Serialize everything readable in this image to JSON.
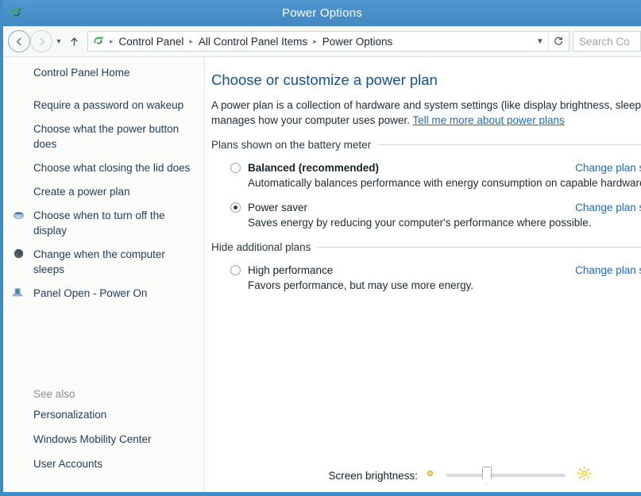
{
  "window": {
    "title": "Power Options",
    "icon": "power-plug-icon"
  },
  "navigation": {
    "back_icon": "back-arrow-icon",
    "forward_icon": "forward-arrow-icon",
    "recent_icon": "chevron-down-icon",
    "up_icon": "up-arrow-icon",
    "breadcrumb_icon": "power-plug-icon",
    "breadcrumbs": [
      "Control Panel",
      "All Control Panel Items",
      "Power Options"
    ],
    "separator": "▸",
    "dropdown_icon": "chevron-down-icon",
    "refresh_icon": "refresh-icon",
    "search_placeholder": "Search Co"
  },
  "sidebar": {
    "home_label": "Control Panel Home",
    "items": [
      {
        "label": "Require a password on wakeup",
        "icon": ""
      },
      {
        "label": "Choose what the power button does",
        "icon": ""
      },
      {
        "label": "Choose what closing the lid does",
        "icon": ""
      },
      {
        "label": "Create a power plan",
        "icon": ""
      },
      {
        "label": "Choose when to turn off the display",
        "icon": "display-icon"
      },
      {
        "label": "Change when the computer sleeps",
        "icon": "sleep-moon-icon"
      },
      {
        "label": "Panel Open - Power On",
        "icon": "laptop-icon"
      }
    ],
    "see_also": {
      "title": "See also",
      "items": [
        {
          "label": "Personalization"
        },
        {
          "label": "Windows Mobility Center"
        },
        {
          "label": "User Accounts"
        }
      ]
    }
  },
  "main": {
    "page_title": "Choose or customize a power plan",
    "intro_text": "A power plan is a collection of hardware and system settings (like display brightness, sleep) that manages how your computer uses power.",
    "intro_link": "Tell me more about power plans",
    "sections": [
      {
        "heading": "Plans shown on the battery meter",
        "plans": [
          {
            "name": "Balanced (recommended)",
            "bold": true,
            "selected": false,
            "description": "Automatically balances performance with energy consumption on capable hardware.",
            "change_label": "Change plan settings"
          },
          {
            "name": "Power saver",
            "bold": false,
            "selected": true,
            "description": "Saves energy by reducing your computer's performance where possible.",
            "change_label": "Change plan settings"
          }
        ]
      },
      {
        "heading": "Hide additional plans",
        "plans": [
          {
            "name": "High performance",
            "bold": false,
            "selected": false,
            "description": "Favors performance, but may use more energy.",
            "change_label": "Change plan settings"
          }
        ]
      }
    ]
  },
  "brightness": {
    "label": "Screen brightness:",
    "low_icon": "sun-dim-icon",
    "high_icon": "sun-bright-icon",
    "value_percent": 34
  },
  "colors": {
    "titlebar": "#4a94cb",
    "window_border": "#3f8cc9",
    "heading": "#14518c",
    "link": "#1f6bb5",
    "sidebar_bg": "#fbfbf9",
    "sun": "#e8c13c"
  }
}
